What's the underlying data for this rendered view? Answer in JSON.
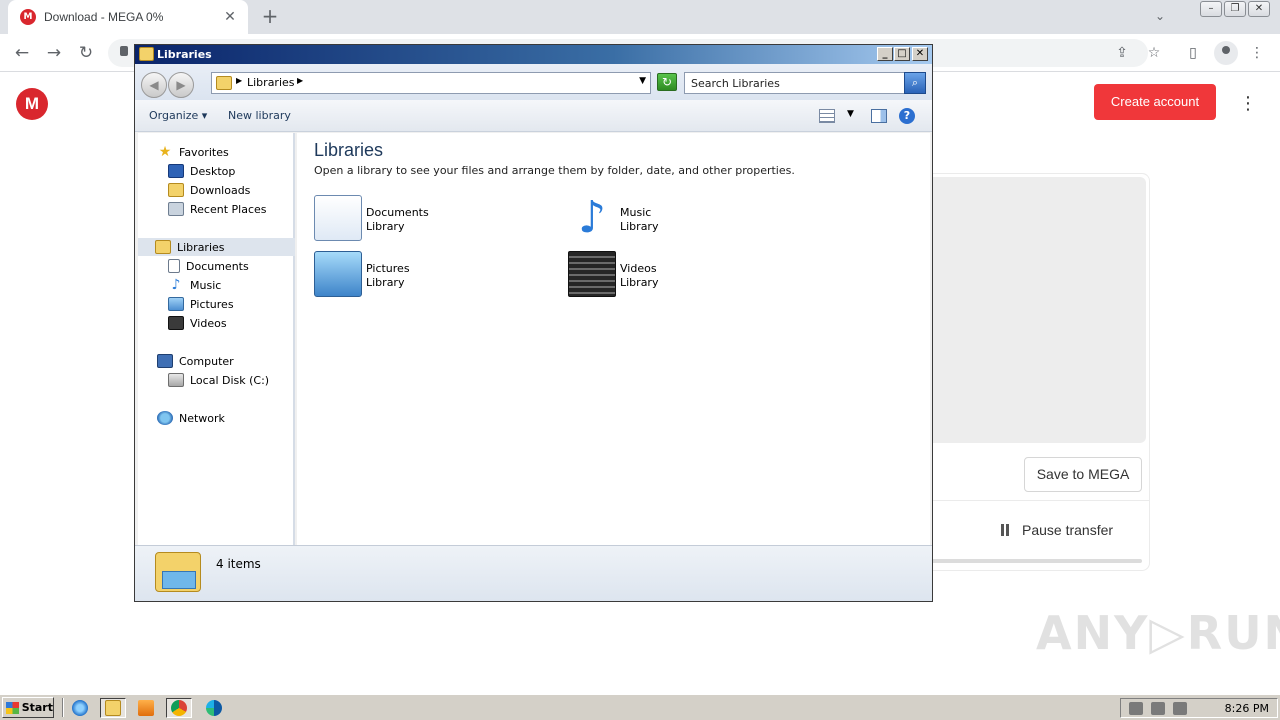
{
  "browser": {
    "tab_title": "Download - MEGA 0%",
    "favicon_letter": "M",
    "tab_close": "✕",
    "new_tab": "+",
    "back": "←",
    "forward": "→",
    "reload": "↻",
    "url": ""
  },
  "mega": {
    "logo_letter": "M",
    "create_account": "Create account",
    "save_to_mega": "Save to MEGA",
    "pause_transfer": "Pause transfer",
    "progress_percent": 0,
    "accent_color": "#f0373a",
    "watermark": "ANY RUN"
  },
  "explorer": {
    "title": "Libraries",
    "caption_buttons": {
      "minimize": "_",
      "maximize": "□",
      "close": "✕"
    },
    "address_crumb": "Libraries",
    "search_placeholder": "Search Libraries",
    "commands": {
      "organize": "Organize",
      "new_library": "New library"
    },
    "nav": {
      "favorites": {
        "label": "Favorites",
        "items": [
          "Desktop",
          "Downloads",
          "Recent Places"
        ]
      },
      "libraries": {
        "label": "Libraries",
        "items": [
          "Documents",
          "Music",
          "Pictures",
          "Videos"
        ]
      },
      "computer": {
        "label": "Computer",
        "items": [
          "Local Disk (C:)"
        ]
      },
      "network": {
        "label": "Network"
      }
    },
    "content": {
      "heading": "Libraries",
      "description": "Open a library to see your files and arrange them by folder, date, and other properties.",
      "libraries": [
        {
          "name": "Documents",
          "kind": "Library",
          "icon": "documents-library-icon"
        },
        {
          "name": "Music",
          "kind": "Library",
          "icon": "music-library-icon"
        },
        {
          "name": "Pictures",
          "kind": "Library",
          "icon": "pictures-library-icon"
        },
        {
          "name": "Videos",
          "kind": "Library",
          "icon": "videos-library-icon"
        }
      ]
    },
    "status": {
      "items": "4 items"
    }
  },
  "taskbar": {
    "start": "Start",
    "clock": "8:26 PM"
  }
}
